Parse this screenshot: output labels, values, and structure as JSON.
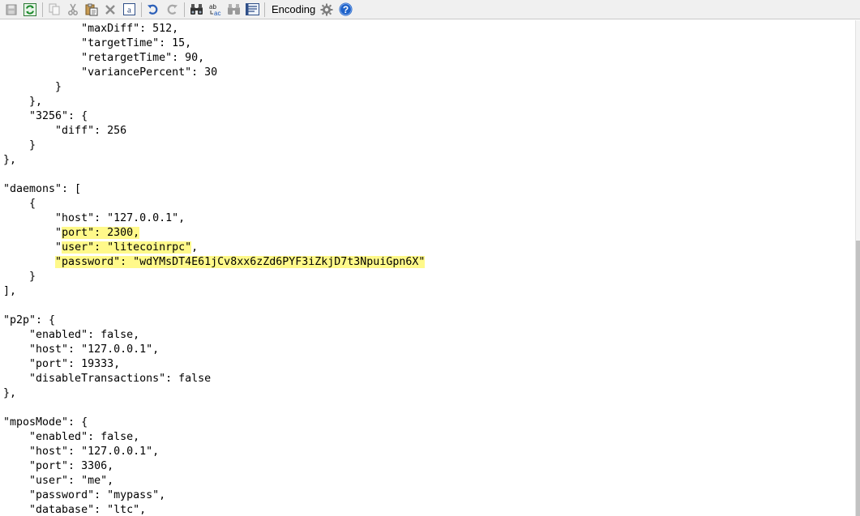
{
  "toolbar": {
    "encoding_label": "Encoding",
    "buttons": [
      {
        "icon": "save-icon"
      },
      {
        "icon": "refresh-icon"
      },
      {
        "icon": "copy-icon"
      },
      {
        "icon": "cut-icon"
      },
      {
        "icon": "paste-icon"
      },
      {
        "icon": "delete-icon"
      },
      {
        "icon": "select-all-icon"
      },
      {
        "icon": "undo-icon"
      },
      {
        "icon": "redo-icon"
      },
      {
        "icon": "find-icon"
      },
      {
        "icon": "replace-icon"
      },
      {
        "icon": "find-next-icon"
      },
      {
        "icon": "word-wrap-icon"
      },
      {
        "icon": "settings-gear-icon"
      },
      {
        "icon": "help-icon"
      }
    ],
    "colors": {
      "refresh": "#1a8a2a",
      "undo": "#2b5fb8",
      "help": "#1e62c9"
    }
  },
  "editor": {
    "highlight_color": "#fff98a",
    "lines": [
      {
        "text": "            \"maxDiff\": 512,"
      },
      {
        "text": "            \"targetTime\": 15,"
      },
      {
        "text": "            \"retargetTime\": 90,"
      },
      {
        "text": "            \"variancePercent\": 30"
      },
      {
        "text": "        }"
      },
      {
        "text": "    },"
      },
      {
        "text": "    \"3256\": {"
      },
      {
        "text": "        \"diff\": 256"
      },
      {
        "text": "    }"
      },
      {
        "text": "},"
      },
      {
        "text": ""
      },
      {
        "text": "\"daemons\": ["
      },
      {
        "text": "    {"
      },
      {
        "text": "        \"host\": \"127.0.0.1\","
      },
      {
        "text": "        \"",
        "highlighted": "port\": 2300,"
      },
      {
        "text": "        \"",
        "highlighted": "user\": \"litecoinrpc\"",
        "after": ","
      },
      {
        "text": "        ",
        "highlighted": "\"password\": \"wdYMsDT4E61jCv8xx6zZd6PYF3iZkjD7t3NpuiGpn6X\""
      },
      {
        "text": "    }"
      },
      {
        "text": "],"
      },
      {
        "text": ""
      },
      {
        "text": "\"p2p\": {"
      },
      {
        "text": "    \"enabled\": false,"
      },
      {
        "text": "    \"host\": \"127.0.0.1\","
      },
      {
        "text": "    \"port\": 19333,"
      },
      {
        "text": "    \"disableTransactions\": false"
      },
      {
        "text": "},"
      },
      {
        "text": ""
      },
      {
        "text": "\"mposMode\": {"
      },
      {
        "text": "    \"enabled\": false,"
      },
      {
        "text": "    \"host\": \"127.0.0.1\","
      },
      {
        "text": "    \"port\": 3306,"
      },
      {
        "text": "    \"user\": \"me\","
      },
      {
        "text": "    \"password\": \"mypass\","
      },
      {
        "text": "    \"database\": \"ltc\","
      }
    ]
  }
}
